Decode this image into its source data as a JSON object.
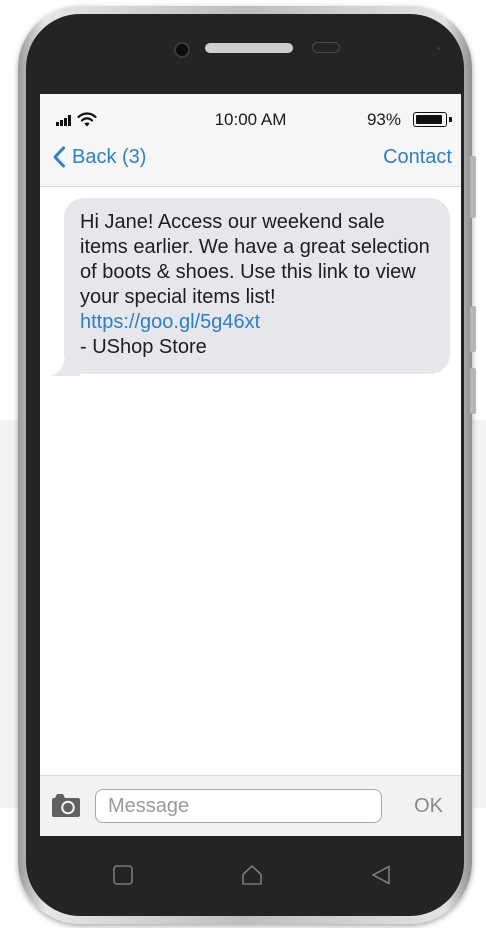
{
  "status_bar": {
    "time": "10:00 AM",
    "battery_percent": "93%",
    "battery_level": 0.93,
    "signal_icon": "signal-bars-icon",
    "wifi_icon": "wifi-icon"
  },
  "nav": {
    "back_label": "Back (3)",
    "contact_label": "Contact",
    "accent_color": "#2f7fc1"
  },
  "message": {
    "text_before_link": "Hi Jane! Access our weekend sale items earlier. We have a great selection of boots & shoes. Use this link to view your special items list! ",
    "link_text": "https://goo.gl/5g46xt",
    "signature": "- UShop Store",
    "bubble_color": "#e7e6eb"
  },
  "input_bar": {
    "placeholder": "Message",
    "send_label": "OK",
    "camera_icon": "camera-icon"
  },
  "soft_keys": {
    "recent_icon": "square-icon",
    "home_icon": "home-icon",
    "back_icon": "triangle-back-icon"
  }
}
